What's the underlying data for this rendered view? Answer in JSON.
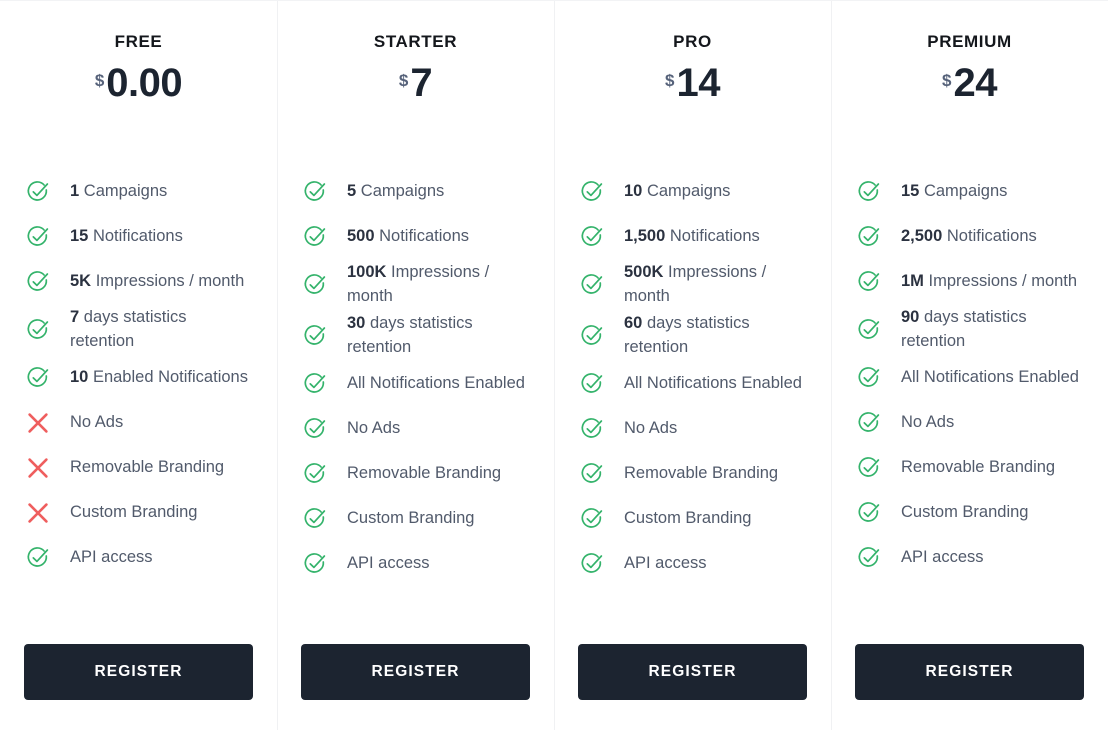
{
  "theme": {
    "background": "#ffffff",
    "divider": "#f0f1f3",
    "check_color": "#34b36b",
    "cross_color": "#ef5e5e",
    "price_color": "#1c2430",
    "currency_color": "#56627a",
    "feature_text_color": "#515a6b",
    "feature_bold_color": "#2b3240",
    "button_background": "#1c2430",
    "button_text": "#ffffff"
  },
  "plans": [
    {
      "name": "FREE",
      "currency": "$",
      "price": "0.00",
      "cta_label": "REGISTER",
      "features": [
        {
          "icon": "check-icon",
          "enabled": true,
          "value": "1",
          "label": "Campaigns"
        },
        {
          "icon": "check-icon",
          "enabled": true,
          "value": "15",
          "label": "Notifications"
        },
        {
          "icon": "check-icon",
          "enabled": true,
          "value": "5K",
          "label": "Impressions / month"
        },
        {
          "icon": "check-icon",
          "enabled": true,
          "value": "7",
          "label": "days statistics retention"
        },
        {
          "icon": "check-icon",
          "enabled": true,
          "value": "10",
          "label": "Enabled Notifications"
        },
        {
          "icon": "cross-icon",
          "enabled": false,
          "value": "",
          "label": "No Ads"
        },
        {
          "icon": "cross-icon",
          "enabled": false,
          "value": "",
          "label": "Removable Branding"
        },
        {
          "icon": "cross-icon",
          "enabled": false,
          "value": "",
          "label": "Custom Branding"
        },
        {
          "icon": "check-icon",
          "enabled": true,
          "value": "",
          "label": "API access"
        }
      ]
    },
    {
      "name": "STARTER",
      "currency": "$",
      "price": "7",
      "cta_label": "REGISTER",
      "features": [
        {
          "icon": "check-icon",
          "enabled": true,
          "value": "5",
          "label": "Campaigns"
        },
        {
          "icon": "check-icon",
          "enabled": true,
          "value": "500",
          "label": "Notifications"
        },
        {
          "icon": "check-icon",
          "enabled": true,
          "value": "100K",
          "label": "Impressions / month"
        },
        {
          "icon": "check-icon",
          "enabled": true,
          "value": "30",
          "label": "days statistics retention"
        },
        {
          "icon": "check-icon",
          "enabled": true,
          "value": "",
          "label": "All Notifications Enabled"
        },
        {
          "icon": "check-icon",
          "enabled": true,
          "value": "",
          "label": "No Ads"
        },
        {
          "icon": "check-icon",
          "enabled": true,
          "value": "",
          "label": "Removable Branding"
        },
        {
          "icon": "check-icon",
          "enabled": true,
          "value": "",
          "label": "Custom Branding"
        },
        {
          "icon": "check-icon",
          "enabled": true,
          "value": "",
          "label": "API access"
        }
      ]
    },
    {
      "name": "PRO",
      "currency": "$",
      "price": "14",
      "cta_label": "REGISTER",
      "features": [
        {
          "icon": "check-icon",
          "enabled": true,
          "value": "10",
          "label": "Campaigns"
        },
        {
          "icon": "check-icon",
          "enabled": true,
          "value": "1,500",
          "label": "Notifications"
        },
        {
          "icon": "check-icon",
          "enabled": true,
          "value": "500K",
          "label": "Impressions / month"
        },
        {
          "icon": "check-icon",
          "enabled": true,
          "value": "60",
          "label": "days statistics retention"
        },
        {
          "icon": "check-icon",
          "enabled": true,
          "value": "",
          "label": "All Notifications Enabled"
        },
        {
          "icon": "check-icon",
          "enabled": true,
          "value": "",
          "label": "No Ads"
        },
        {
          "icon": "check-icon",
          "enabled": true,
          "value": "",
          "label": "Removable Branding"
        },
        {
          "icon": "check-icon",
          "enabled": true,
          "value": "",
          "label": "Custom Branding"
        },
        {
          "icon": "check-icon",
          "enabled": true,
          "value": "",
          "label": "API access"
        }
      ]
    },
    {
      "name": "PREMIUM",
      "currency": "$",
      "price": "24",
      "cta_label": "REGISTER",
      "features": [
        {
          "icon": "check-icon",
          "enabled": true,
          "value": "15",
          "label": "Campaigns"
        },
        {
          "icon": "check-icon",
          "enabled": true,
          "value": "2,500",
          "label": "Notifications"
        },
        {
          "icon": "check-icon",
          "enabled": true,
          "value": "1M",
          "label": "Impressions / month"
        },
        {
          "icon": "check-icon",
          "enabled": true,
          "value": "90",
          "label": "days statistics retention"
        },
        {
          "icon": "check-icon",
          "enabled": true,
          "value": "",
          "label": "All Notifications Enabled"
        },
        {
          "icon": "check-icon",
          "enabled": true,
          "value": "",
          "label": "No Ads"
        },
        {
          "icon": "check-icon",
          "enabled": true,
          "value": "",
          "label": "Removable Branding"
        },
        {
          "icon": "check-icon",
          "enabled": true,
          "value": "",
          "label": "Custom Branding"
        },
        {
          "icon": "check-icon",
          "enabled": true,
          "value": "",
          "label": "API access"
        }
      ]
    }
  ]
}
